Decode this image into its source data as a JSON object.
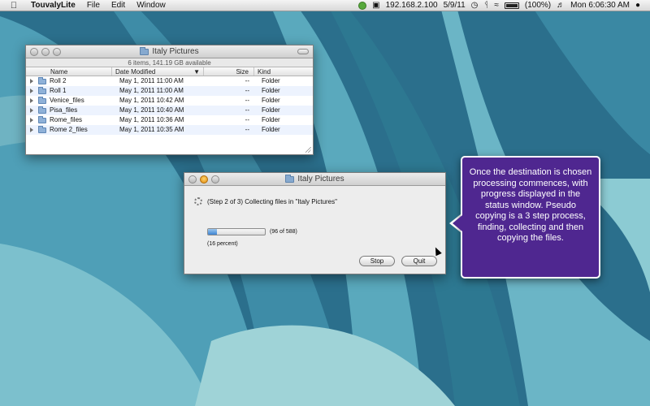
{
  "menubar": {
    "app_name": "TouvalyLite",
    "menus": [
      "File",
      "Edit",
      "Window"
    ],
    "ip_address": "192.168.2.100",
    "date": "5/9/11",
    "battery": "(100%)",
    "clock": "Mon 6:06:30 AM"
  },
  "finder": {
    "title": "Italy Pictures",
    "status": "6 items, 141.19 GB available",
    "columns": {
      "name": "Name",
      "date": "Date Modified",
      "size": "Size",
      "kind": "Kind"
    },
    "rows": [
      {
        "name": "Roll 2",
        "date": "May 1, 2011 11:00 AM",
        "size": "--",
        "kind": "Folder"
      },
      {
        "name": "Roll 1",
        "date": "May 1, 2011 11:00 AM",
        "size": "--",
        "kind": "Folder"
      },
      {
        "name": "Venice_files",
        "date": "May 1, 2011 10:42 AM",
        "size": "--",
        "kind": "Folder"
      },
      {
        "name": "Pisa_files",
        "date": "May 1, 2011 10:40 AM",
        "size": "--",
        "kind": "Folder"
      },
      {
        "name": "Rome_files",
        "date": "May 1, 2011 10:36 AM",
        "size": "--",
        "kind": "Folder"
      },
      {
        "name": "Rome 2_files",
        "date": "May 1, 2011 10:35 AM",
        "size": "--",
        "kind": "Folder"
      }
    ]
  },
  "progress": {
    "title": "Italy Pictures",
    "step_text": "(Step 2 of 3) Collecting files in \"Italy Pictures\"",
    "count_text": "(96 of 588)",
    "percent_text": "(16 percent)",
    "progress_fraction": 0.16,
    "stop_label": "Stop",
    "quit_label": "Quit"
  },
  "callout": {
    "text": "Once the destination is chosen processing commences, with progress displayed in the status window. Pseudo copying is a 3 step process, finding, collecting and then copying the files."
  },
  "colors": {
    "callout_bg": "#4f2790",
    "wallpaper": "#2f7a96",
    "progress_fill": "#3d84d2"
  }
}
